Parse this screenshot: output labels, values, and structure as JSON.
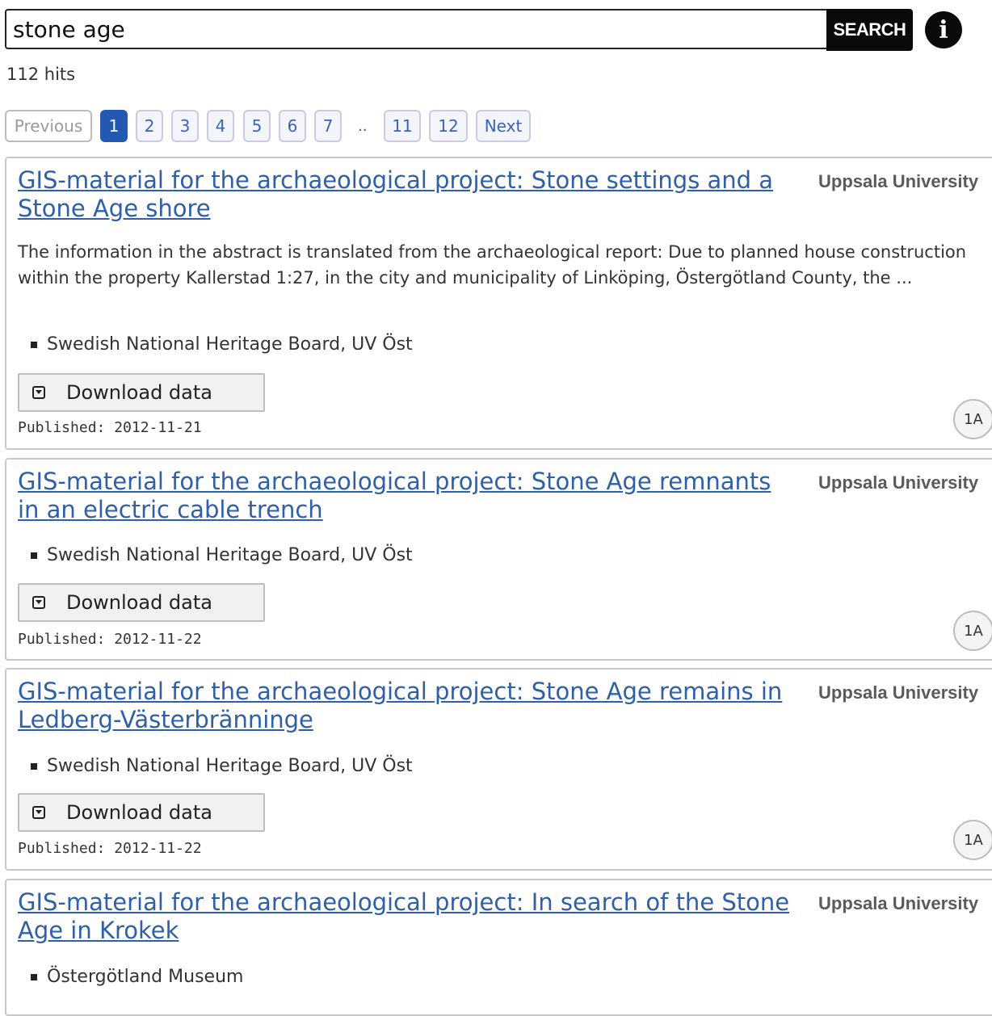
{
  "search": {
    "value": "stone age",
    "button_label": "SEARCH",
    "info_icon": "info-icon"
  },
  "hit_count": "112 hits",
  "pagination": {
    "previous": "Previous",
    "pages": [
      "1",
      "2",
      "3",
      "4",
      "5",
      "6",
      "7"
    ],
    "ellipsis": "..",
    "last_pages": [
      "11",
      "12"
    ],
    "next": "Next",
    "current": "1"
  },
  "results": [
    {
      "title": "GIS-material for the archaeological project: Stone settings and a Stone Age shore",
      "organization": "Uppsala University",
      "abstract": "The information in the abstract is translated from the archaeological report: Due to planned house construction within the property Kallerstad 1:27, in the city and municipality of Linköping, Östergötland County, the ...",
      "contributor": "Swedish National Heritage Board, UV Öst",
      "download_label": "Download data",
      "published": "Published: 2012-11-21",
      "level": "1A"
    },
    {
      "title": "GIS-material for the archaeological project: Stone Age remnants in an electric cable trench",
      "organization": "Uppsala University",
      "contributor": "Swedish National Heritage Board, UV Öst",
      "download_label": "Download data",
      "published": "Published: 2012-11-22",
      "level": "1A"
    },
    {
      "title": "GIS-material for the archaeological project: Stone Age remains in Ledberg-Västerbränninge",
      "organization": "Uppsala University",
      "contributor": "Swedish National Heritage Board, UV Öst",
      "download_label": "Download data",
      "published": "Published: 2012-11-22",
      "level": "1A"
    },
    {
      "title": "GIS-material for the archaeological project: In search of the Stone Age in Krokek",
      "organization": "Uppsala University",
      "contributor": "Östergötland Museum"
    }
  ],
  "colors": {
    "link": "#2e5fa8",
    "active_page": "#2358b5",
    "search_button": "#0a0a0a"
  }
}
